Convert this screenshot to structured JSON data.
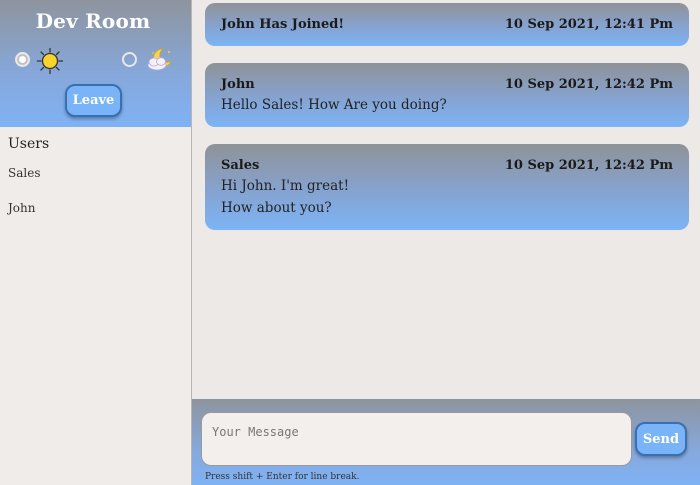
{
  "sidebar": {
    "room_title": "Dev Room",
    "theme": {
      "light_selected": true,
      "light_icon": "sun-icon",
      "dark_icon": "moon-cloud-icon"
    },
    "leave_label": "Leave",
    "users_heading": "Users",
    "users": [
      "Sales",
      "John"
    ]
  },
  "messages": [
    {
      "author": "John Has Joined!",
      "time": "10 Sep 2021, 12:41 Pm",
      "lines": []
    },
    {
      "author": "John",
      "time": "10 Sep 2021, 12:42 Pm",
      "lines": [
        "Hello Sales! How Are you doing?"
      ]
    },
    {
      "author": "Sales",
      "time": "10 Sep 2021, 12:42 Pm",
      "lines": [
        "Hi John. I'm great!",
        "How about you?"
      ]
    }
  ],
  "composer": {
    "placeholder": "Your Message",
    "value": "",
    "send_label": "Send",
    "hint": "Press shift + Enter for line break."
  },
  "colors": {
    "accent": "#7ab4f8",
    "accent_border": "#3a6fb0",
    "header_gradient_top": "#8e949e",
    "header_gradient_bottom": "#7fb2f4",
    "background": "#ede9e7"
  }
}
